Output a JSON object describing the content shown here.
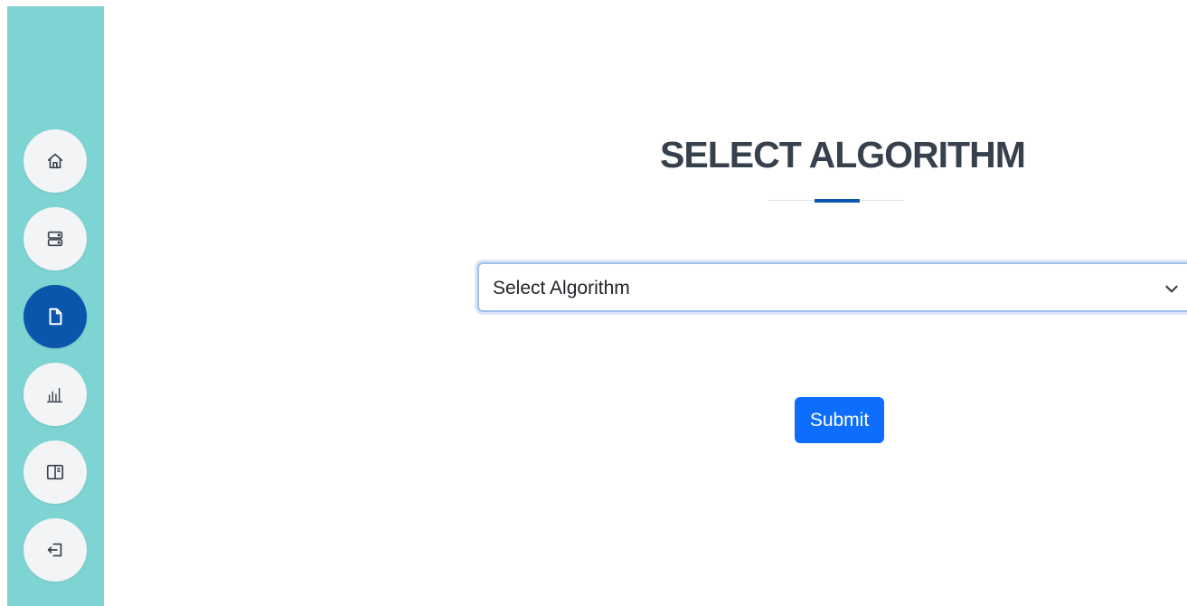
{
  "sidebar": {
    "items": [
      {
        "icon": "home-icon",
        "active": false
      },
      {
        "icon": "server-icon",
        "active": false
      },
      {
        "icon": "file-icon",
        "active": true
      },
      {
        "icon": "bar-chart-icon",
        "active": false
      },
      {
        "icon": "layout-icon",
        "active": false
      },
      {
        "icon": "logout-icon",
        "active": false
      }
    ]
  },
  "main": {
    "title": "SELECT ALGORITHM",
    "select": {
      "selected_value": "Select Algorithm"
    },
    "submit_label": "Submit"
  },
  "colors": {
    "sidebar_bg": "#7ed3d3",
    "active_nav": "#0a56ad",
    "primary_button": "#0d6efd",
    "title_text": "#37414d"
  }
}
